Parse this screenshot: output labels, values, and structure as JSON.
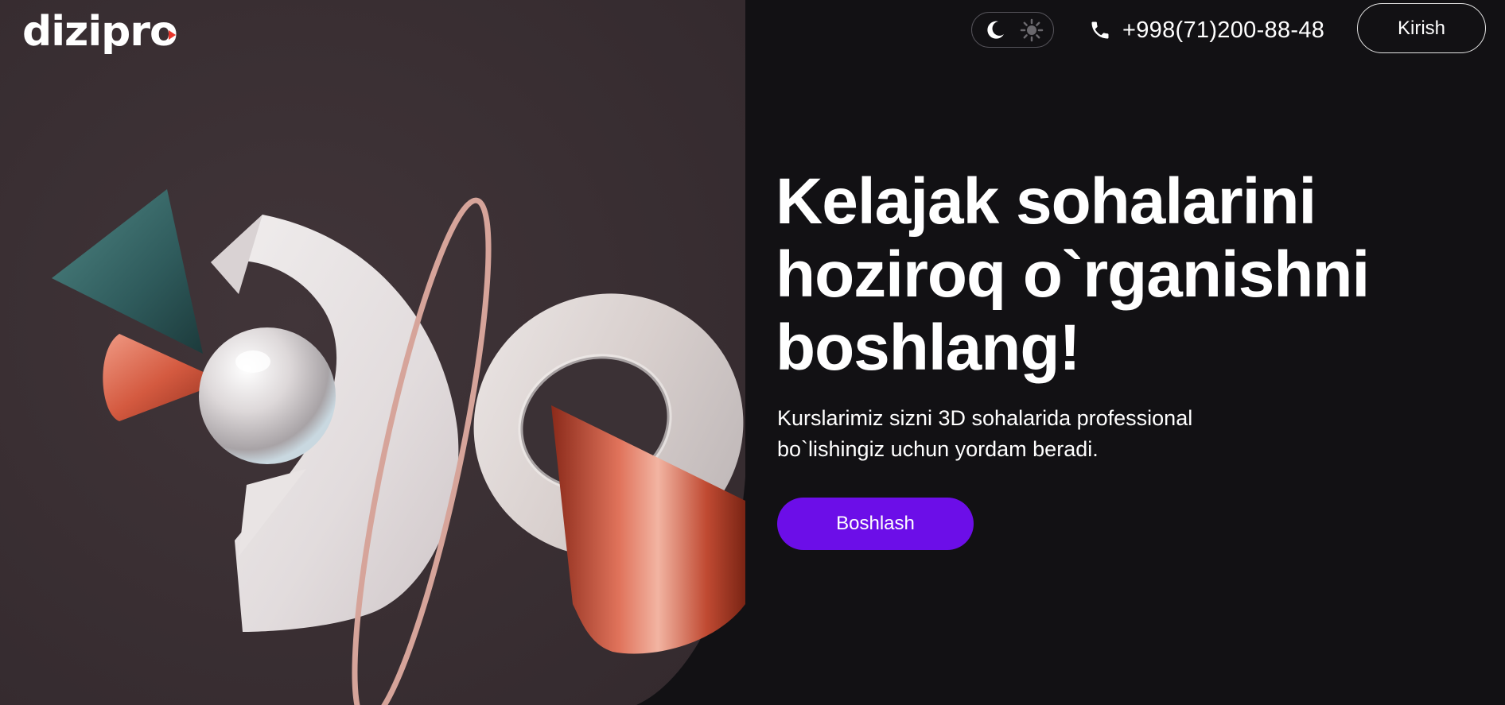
{
  "brand": {
    "logo_text": "dizipro"
  },
  "header": {
    "theme_toggle": {
      "dark_icon": "moon-icon",
      "light_icon": "sun-icon",
      "active": "dark"
    },
    "phone": {
      "icon": "phone-icon",
      "number": "+998(71)200-88-48"
    },
    "login_label": "Kirish"
  },
  "hero": {
    "title_lines": [
      "Kelajak sohalarini",
      "hoziroq o`rganishni",
      "boshlang!"
    ],
    "subtitle_lines": [
      "Kurslarimiz sizni 3D sohalarida professional",
      "bo`lishingiz uchun yordam beradi."
    ],
    "cta_label": "Boshlash"
  },
  "colors": {
    "background": "#121114",
    "art_panel": "#3b3135",
    "accent": "#6c0ee8",
    "logo_mark": "#e8352b",
    "copper": "#d1583f",
    "teal": "#3f6f6e"
  }
}
